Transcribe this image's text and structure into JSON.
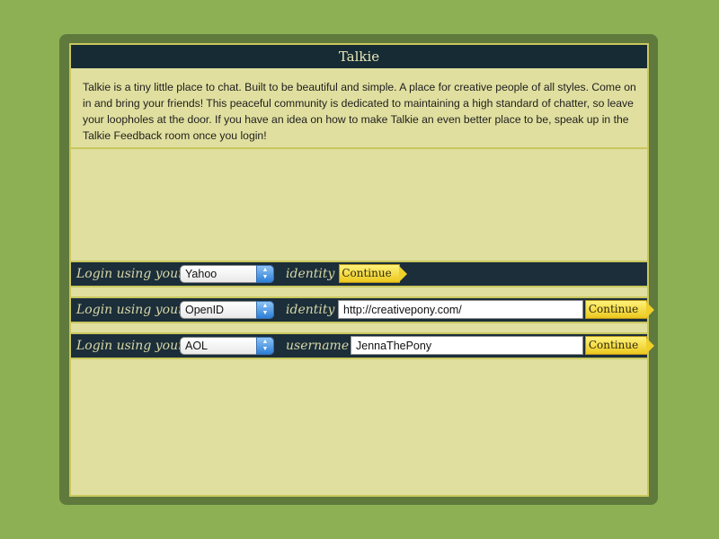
{
  "app": {
    "title": "Talkie"
  },
  "intro": {
    "text": "Talkie is a tiny little place to chat. Built to be beautiful and simple. A place for creative people of all styles. Come on in and bring your friends!  This peaceful community is dedicated to maintaining a high standard of chatter, so leave your loopholes at the door.  If you have an idea on how to make Talkie an even better place to be, speak up in the Talkie Feedback room once you login!"
  },
  "logins": [
    {
      "prefix": "Login using your",
      "provider": "Yahoo",
      "suffix": "identity",
      "field_value": "",
      "button": "Continue"
    },
    {
      "prefix": "Login using your",
      "provider": "OpenID",
      "suffix": "identity",
      "field_value": "http://creativepony.com/",
      "button": "Continue"
    },
    {
      "prefix": "Login using your",
      "provider": "AOL",
      "suffix": "username",
      "field_value": "JennaThePony",
      "button": "Continue"
    }
  ],
  "colors": {
    "page_background": "#8db054",
    "frame": "#5f7a3c",
    "panel": "#e0df9f",
    "bar": "#172b35",
    "button": "#f2d22c"
  },
  "icons": {
    "select_arrow": "up-down-arrows-icon"
  }
}
